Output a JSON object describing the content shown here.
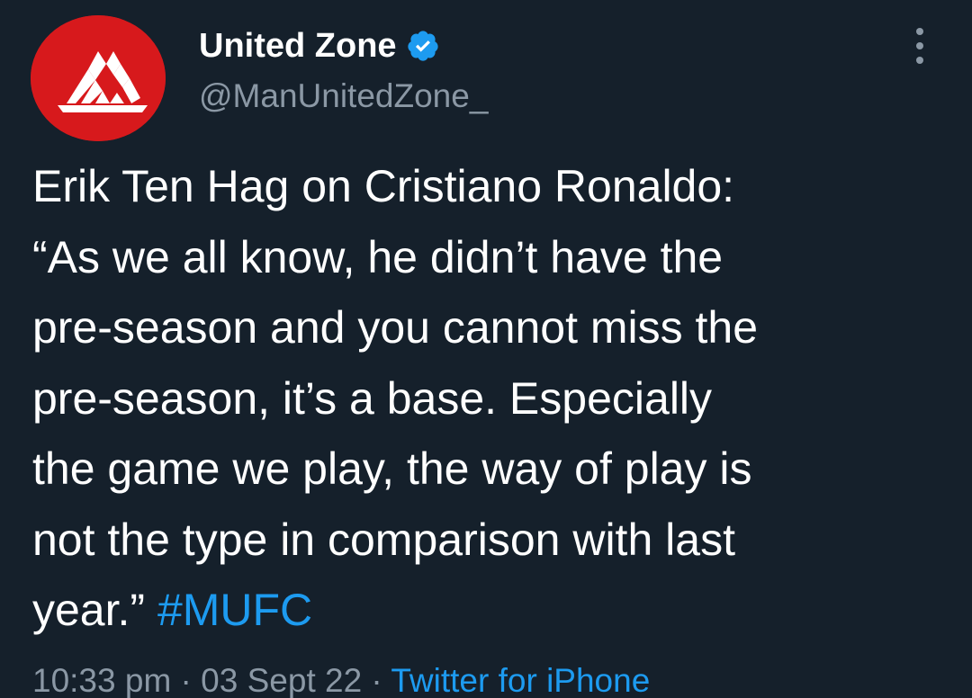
{
  "author": {
    "display_name": "United Zone",
    "handle": "@ManUnitedZone_",
    "verified": true,
    "avatar_icon": "united-zone-logo",
    "avatar_color": "#d7191c"
  },
  "menu": {
    "icon": "more-vertical-icon"
  },
  "tweet": {
    "lines": [
      "Erik Ten Hag on Cristiano Ronaldo:",
      "“As we all know, he didn’t have the",
      "pre-season and you cannot miss the",
      "pre-season, it’s a base. Especially",
      "the game we play, the way of play is",
      "not the type in comparison with last"
    ],
    "last_line_text": "year.” ",
    "hashtag": "#MUFC"
  },
  "meta": {
    "time": "10:33 pm",
    "separator_1": " · ",
    "date": "03 Sept 22",
    "separator_2": " · ",
    "source": "Twitter for iPhone"
  },
  "colors": {
    "background": "#15202b",
    "text": "#ffffff",
    "secondary_text": "#8b98a5",
    "accent": "#1d9bf0"
  }
}
